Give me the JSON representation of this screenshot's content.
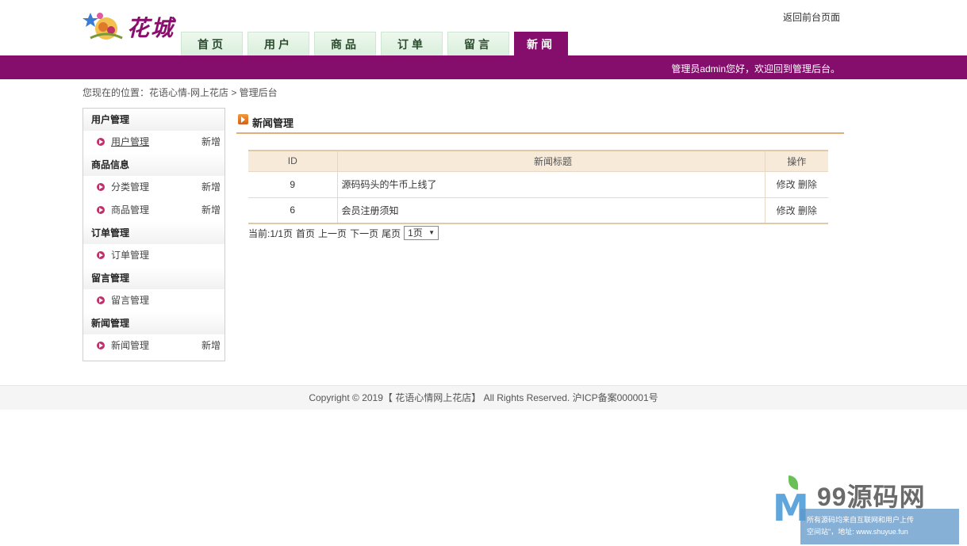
{
  "header": {
    "logo_text": "花城",
    "back_link": "返回前台页面",
    "nav": [
      "首页",
      "用户",
      "商品",
      "订单",
      "留言",
      "新闻"
    ],
    "active_tab": "新闻",
    "welcome": "管理员admin您好，欢迎回到管理后台。"
  },
  "breadcrumb": "您现在的位置：花语心情-网上花店 > 管理后台",
  "sidebar": {
    "groups": [
      {
        "title": "用户管理",
        "items": [
          {
            "label": "用户管理",
            "add": "新增"
          }
        ]
      },
      {
        "title": "商品信息",
        "items": [
          {
            "label": "分类管理",
            "add": "新增"
          },
          {
            "label": "商品管理",
            "add": "新增"
          }
        ]
      },
      {
        "title": "订单管理",
        "items": [
          {
            "label": "订单管理"
          }
        ]
      },
      {
        "title": "留言管理",
        "items": [
          {
            "label": "留言管理"
          }
        ]
      },
      {
        "title": "新闻管理",
        "items": [
          {
            "label": "新闻管理",
            "add": "新增"
          }
        ]
      }
    ]
  },
  "main": {
    "title": "新闻管理",
    "columns": {
      "id": "ID",
      "title": "新闻标题",
      "op": "操作"
    },
    "rows": [
      {
        "id": "9",
        "title": "源码码头的牛币上线了",
        "edit": "修改",
        "delete": "删除"
      },
      {
        "id": "6",
        "title": "会员注册须知",
        "edit": "修改",
        "delete": "删除"
      }
    ],
    "pager": {
      "current": "当前:1/1页",
      "first": "首页",
      "prev": "上一页",
      "next": "下一页",
      "last": "尾页",
      "select": "1页"
    }
  },
  "footer": "Copyright © 2019【 花语心情网上花店】 All Rights Reserved. 沪ICP备案000001号",
  "watermark": {
    "letter": "M",
    "title": "99源码网",
    "line1": "所有源码均来自互联网和用户上传",
    "line2": "空间站\"，地址: www.shuyue.fun"
  },
  "colors": {
    "brand": "#850d6b",
    "table_header": "#f7ead9",
    "title_rule": "#e0b07c"
  }
}
